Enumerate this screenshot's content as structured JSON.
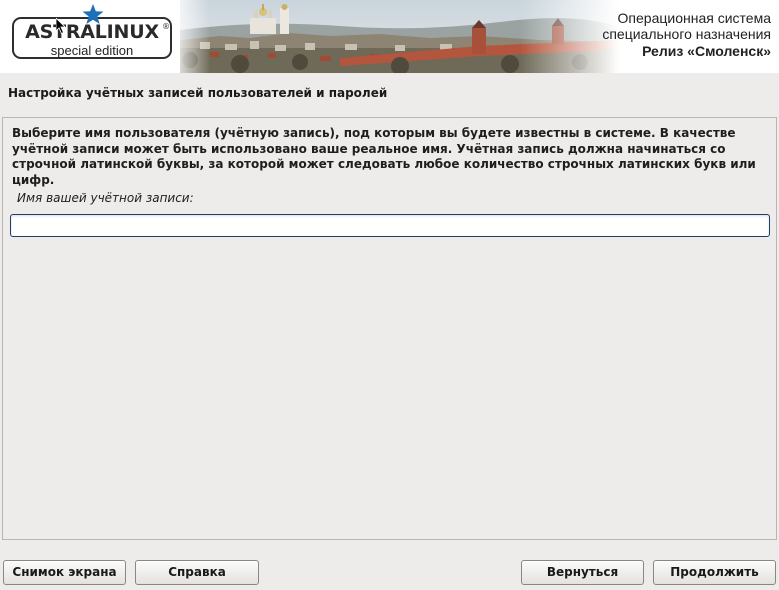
{
  "banner": {
    "logo_brand": "ASTRALINUX",
    "logo_registered": "®",
    "logo_edition": "special edition",
    "os_line1": "Операционная система",
    "os_line2": "специального назначения",
    "os_release": "Релиз «Смоленск»",
    "star_color": "#1f6fb8"
  },
  "page": {
    "title": "Настройка учётных записей пользователей и паролей"
  },
  "form": {
    "description": "Выберите имя пользователя (учётную запись), под которым вы будете известны в системе. В качестве учётной записи может быть использовано ваше реальное имя. Учётная запись должна начинаться со строчной латинской буквы, за которой может следовать любое количество строчных латинских букв или цифр.",
    "field_label": "Имя вашей учётной записи:",
    "username_value": ""
  },
  "buttons": {
    "screenshot": "Снимок экрана",
    "help": "Справка",
    "back": "Вернуться",
    "continue": "Продолжить"
  }
}
